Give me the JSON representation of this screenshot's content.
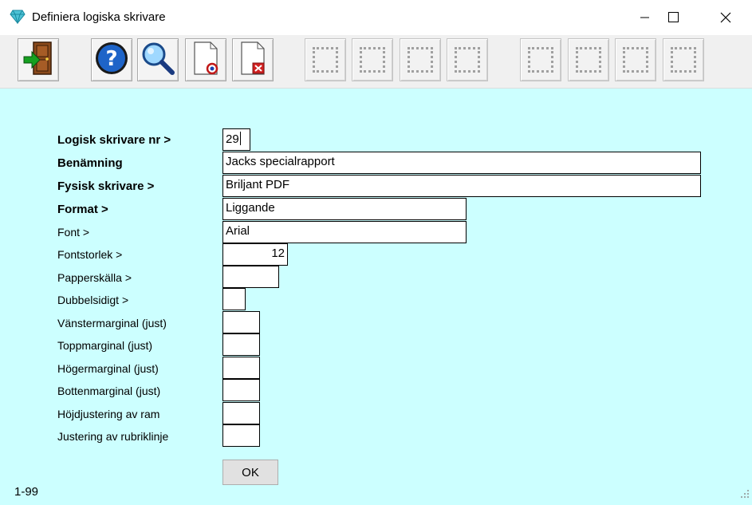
{
  "window": {
    "title": "Definiera logiska skrivare",
    "minimize": "—",
    "maximize": "☐",
    "close": "✕"
  },
  "toolbar": {
    "buttons": [
      {
        "name": "exit-door",
        "icon": "exit-door-icon"
      },
      {
        "name": "help",
        "icon": "help-icon",
        "glyph": "?"
      },
      {
        "name": "search",
        "icon": "search-icon"
      },
      {
        "name": "new-document",
        "icon": "new-document-icon"
      },
      {
        "name": "delete-document",
        "icon": "delete-document-icon"
      }
    ]
  },
  "form": {
    "labels": {
      "logisk_nr": "Logisk skrivare nr >",
      "benamning": "Benämning",
      "fysisk": "Fysisk skrivare >",
      "format": "Format >",
      "font": "Font >",
      "fontstorlek": "Fontstorlek >",
      "papperskalla": "Papperskälla >",
      "dubbelsidigt": "Dubbelsidigt >",
      "vanstermarginal": "Vänstermarginal (just)",
      "toppmarginal": "Toppmarginal (just)",
      "hogermarginal": "Högermarginal (just)",
      "bottenmarginal": "Bottenmarginal (just)",
      "hojdjustering": "Höjdjustering av ram",
      "rubriklinje": "Justering av rubriklinje"
    },
    "values": {
      "logisk_nr": "29",
      "benamning": "Jacks specialrapport",
      "fysisk": "Briljant PDF",
      "format": "Liggande",
      "font": "Arial",
      "fontstorlek": "12",
      "papperskalla": "",
      "dubbelsidigt": "",
      "vanstermarginal": "",
      "toppmarginal": "",
      "hogermarginal": "",
      "bottenmarginal": "",
      "hojdjustering": "",
      "rubriklinje": ""
    },
    "ok_label": "OK"
  },
  "status": {
    "range": "1-99"
  },
  "colors": {
    "background": "#ccffff",
    "help_blue": "#1e64c8"
  }
}
